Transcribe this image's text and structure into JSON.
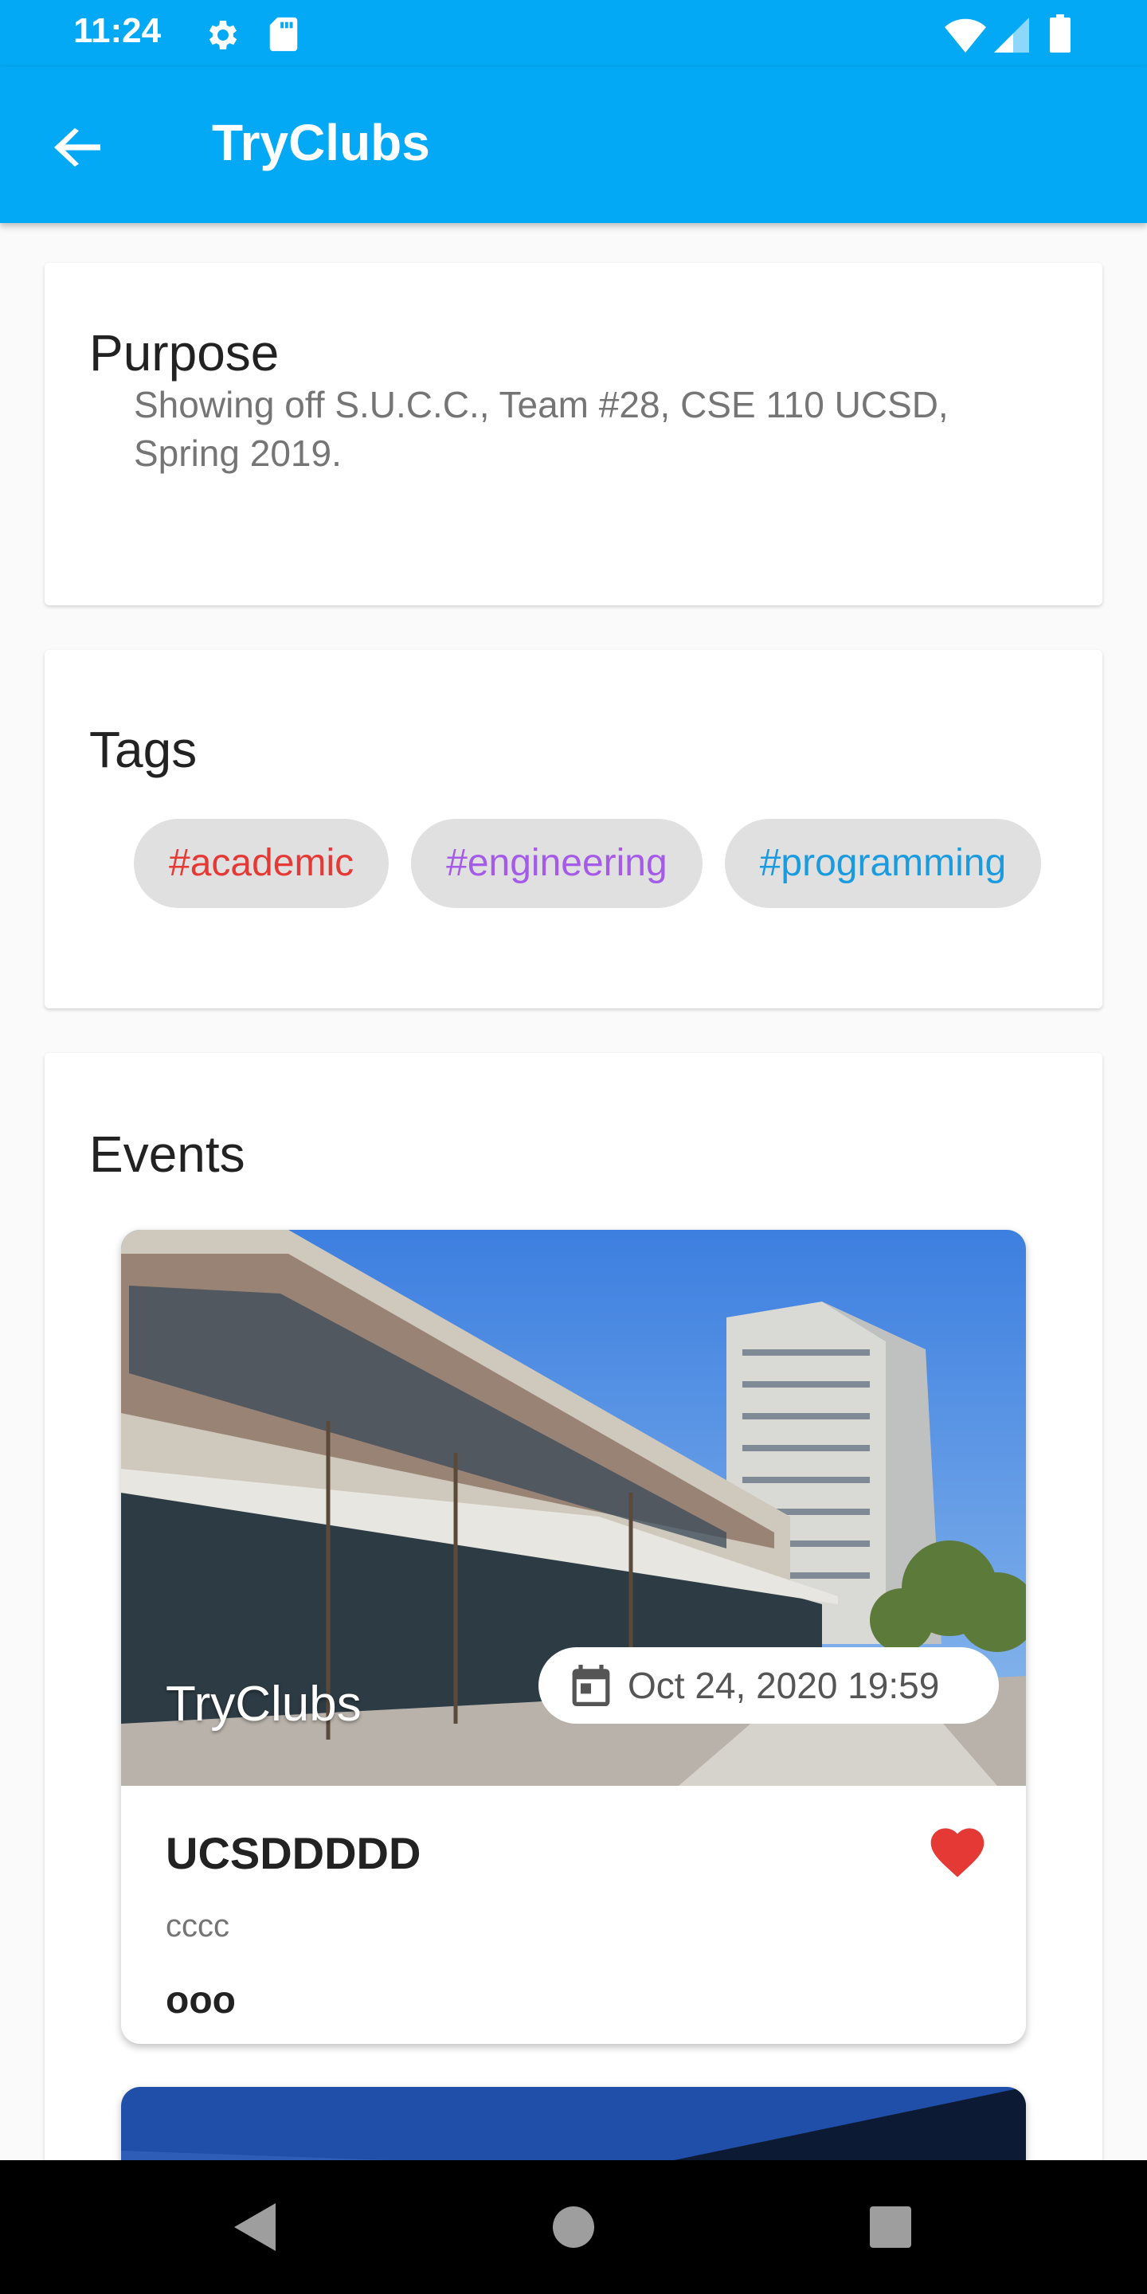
{
  "status_bar": {
    "time": "11:24"
  },
  "app_bar": {
    "title": "TryClubs"
  },
  "purpose": {
    "title": "Purpose",
    "text": "Showing off S.U.C.C., Team #28, CSE 110 UCSD, Spring 2019."
  },
  "tags": {
    "title": "Tags",
    "items": [
      {
        "label": "#academic",
        "color": "#e53935"
      },
      {
        "label": "#engineering",
        "color": "#a35be8"
      },
      {
        "label": "#programming",
        "color": "#1a9be0"
      }
    ]
  },
  "events": {
    "title": "Events",
    "items": [
      {
        "club": "TryClubs",
        "datetime": "Oct 24, 2020 19:59",
        "name": "UCSDDDDD",
        "subtitle": "cccc",
        "description": "ooo",
        "favorited": true
      }
    ]
  },
  "colors": {
    "primary": "#03a9f4",
    "heart": "#e53935"
  }
}
